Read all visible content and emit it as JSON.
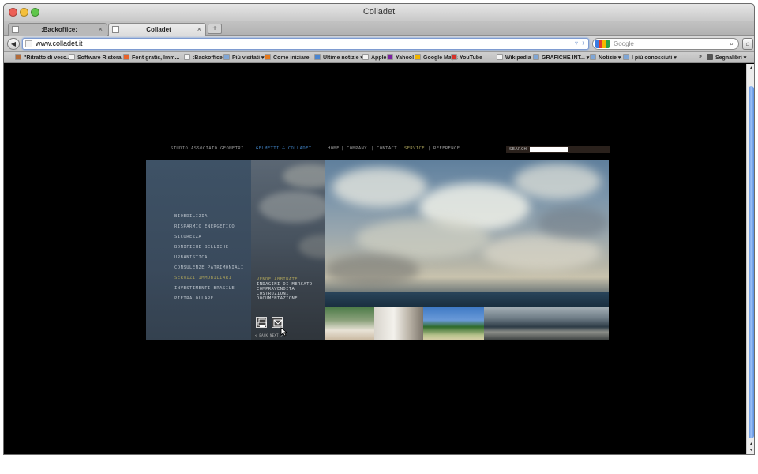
{
  "window": {
    "title": "Colladet"
  },
  "tabs": [
    {
      "label": ":Backoffice:",
      "close": "×"
    },
    {
      "label": "Colladet",
      "close": "×"
    }
  ],
  "new_tab_label": "+",
  "url": "www.colladet.it",
  "search_placeholder": "Google",
  "bookmarks": [
    {
      "label": "\"Ritratto di vecc...",
      "icon": "avatar-icon",
      "color": "#b36b3a"
    },
    {
      "label": "Software Ristora...",
      "icon": "page-icon",
      "color": "#f4f4f4"
    },
    {
      "label": "Font gratis, Imm...",
      "icon": "font-icon",
      "color": "#e8622a"
    },
    {
      "label": ":Backoffice:",
      "icon": "page-icon",
      "color": "#f4f4f4"
    },
    {
      "label": "Più visitati ▾",
      "icon": "folder-icon",
      "color": "#7fa6d6"
    },
    {
      "label": "Come iniziare",
      "icon": "firefox-icon",
      "color": "#e67a1e"
    },
    {
      "label": "Ultime notizie ▾",
      "icon": "rss-icon",
      "color": "#4b86d1"
    },
    {
      "label": "Apple",
      "icon": "page-icon",
      "color": "#f4f4f4"
    },
    {
      "label": "Yahoo!",
      "icon": "yahoo-icon",
      "color": "#7b1fa2"
    },
    {
      "label": "Google Maps",
      "icon": "maps-icon",
      "color": "#f0b400"
    },
    {
      "label": "YouTube",
      "icon": "youtube-icon",
      "color": "#d6312a"
    },
    {
      "label": "Wikipedia",
      "icon": "page-icon",
      "color": "#f4f4f4"
    },
    {
      "label": "GRAFICHE INT... ▾",
      "icon": "folder-icon",
      "color": "#7fa6d6"
    },
    {
      "label": "Notizie ▾",
      "icon": "folder-icon",
      "color": "#7fa6d6"
    },
    {
      "label": "I più conosciuti ▾",
      "icon": "folder-icon",
      "color": "#7fa6d6"
    }
  ],
  "bookmarks_overflow": "»",
  "bookmarks_right": "Segnalibri ▾",
  "site": {
    "brand": "STUDIO ASSOCIATO GEOMETRI",
    "separator": "|",
    "brand_names": "GELMETTI & COLLADET",
    "nav": [
      "HOME",
      "COMPANY",
      "CONTACT",
      "SERVICE",
      "REFERENCE"
    ],
    "nav_active": "SERVICE",
    "search_label": "SEARCH",
    "menu": [
      "BIOEDILIZIA",
      "RISPARMIO ENERGETICO",
      "SICUREZZA",
      "BONIFICHE BELLICHE",
      "URBANISTICA",
      "CONSULENZE PATRIMONIALI",
      "SERVIZI IMMOBILIARI",
      "INVESTIMENTI BRASILE",
      "PIETRA OLLARE"
    ],
    "menu_active": "SERVIZI IMMOBILIARI",
    "submenu": [
      "VENDE ABBINATE",
      "INDAGINI DI MERCATO",
      "COMPRAVENDITA",
      "COSTRUZIONI",
      "DOCUMENTAZIONE"
    ],
    "submenu_active": "VENDE ABBINATE",
    "back_next": "< BACK  NEXT >",
    "accent_color": "#a9a05a",
    "brand_color": "#3f7fbf"
  }
}
